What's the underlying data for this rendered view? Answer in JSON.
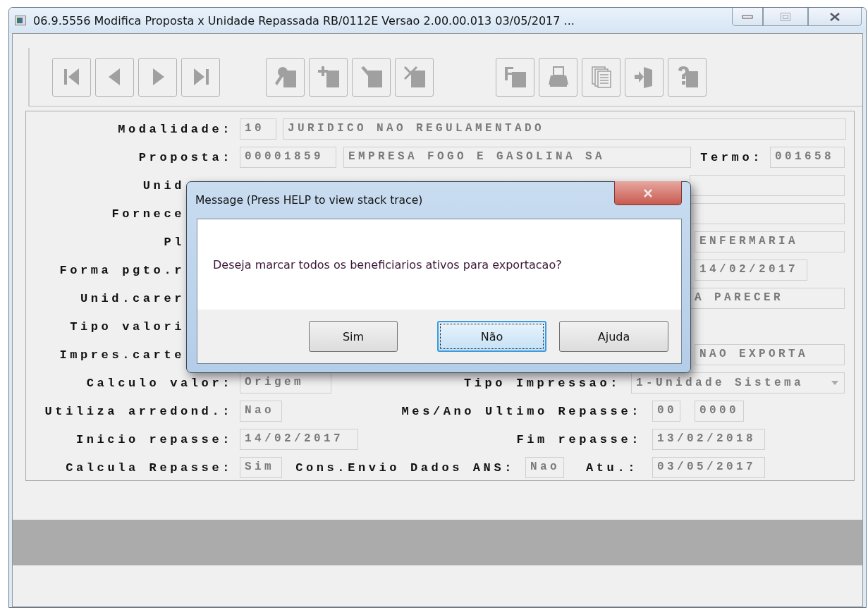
{
  "window": {
    "title": "06.9.5556  Modifica  Proposta x Unidade Repassada RB/0112E Versao 2.00.00.013 03/05/2017 ..."
  },
  "form_rows": [
    {
      "kind": "full",
      "items": [
        {
          "kind": "label",
          "text": "Modalidade:"
        },
        {
          "kind": "field",
          "text": "10"
        },
        {
          "kind": "field",
          "text": "JURIDICO NAO REGULAMENTADO"
        }
      ]
    },
    {
      "kind": "full",
      "items": [
        {
          "kind": "label",
          "text": "Proposta:"
        },
        {
          "kind": "field",
          "text": "00001859"
        },
        {
          "kind": "field",
          "text": "EMPRESA FOGO E GASOLINA SA"
        },
        {
          "kind": "label",
          "text": "Termo:"
        },
        {
          "kind": "field",
          "text": "001658"
        }
      ]
    },
    {
      "kind": "covered",
      "items": [
        {
          "kind": "label",
          "text": "Unid"
        },
        {
          "kind": "field"
        }
      ]
    },
    {
      "kind": "covered",
      "items": [
        {
          "kind": "label",
          "text": "Fornece"
        },
        {
          "kind": "field"
        }
      ]
    },
    {
      "kind": "covered",
      "items": [
        {
          "kind": "label",
          "text": "Pl"
        },
        {
          "kind": "field",
          "text": "ENFERMARIA"
        }
      ]
    },
    {
      "kind": "covered",
      "items": [
        {
          "kind": "label",
          "text": "Forma pgto.r"
        },
        {
          "kind": "field",
          "text": "14/02/2017"
        }
      ]
    },
    {
      "kind": "covered",
      "items": [
        {
          "kind": "label",
          "text": "Unid.carer"
        },
        {
          "kind": "field",
          "text": "A PARECER"
        }
      ]
    },
    {
      "kind": "covered",
      "items": [
        {
          "kind": "label",
          "text": "Tipo valori"
        }
      ]
    },
    {
      "kind": "covered",
      "items": [
        {
          "kind": "label",
          "text": "Impres.carte"
        },
        {
          "kind": "field",
          "text": "NAO EXPORTA"
        }
      ]
    },
    {
      "kind": "full",
      "items": [
        {
          "kind": "label",
          "text": "Calculo valor:"
        },
        {
          "kind": "field",
          "text": "Origem"
        },
        {
          "kind": "label",
          "text": "Tipo Impressao:"
        },
        {
          "kind": "select",
          "text": "1-Unidade Sistema"
        }
      ]
    },
    {
      "kind": "full",
      "items": [
        {
          "kind": "label",
          "text": "Utiliza arredond.:"
        },
        {
          "kind": "field",
          "text": "Nao"
        },
        {
          "kind": "label",
          "text": "Mes/Ano Ultimo Repasse:"
        },
        {
          "kind": "field",
          "text": "00"
        },
        {
          "kind": "field",
          "text": "0000"
        }
      ]
    },
    {
      "kind": "full",
      "items": [
        {
          "kind": "label",
          "text": "Inicio repasse:"
        },
        {
          "kind": "field",
          "text": "14/02/2017"
        },
        {
          "kind": "label",
          "text": "Fim repasse:"
        },
        {
          "kind": "field",
          "text": "13/02/2018"
        }
      ]
    },
    {
      "kind": "full",
      "items": [
        {
          "kind": "label",
          "text": "Calcula Repasse:"
        },
        {
          "kind": "field",
          "text": "Sim"
        },
        {
          "kind": "label",
          "text": "Cons.Envio Dados ANS:"
        },
        {
          "kind": "field",
          "text": "Nao"
        },
        {
          "kind": "label",
          "text": "Atu.:"
        },
        {
          "kind": "field",
          "text": "03/05/2017"
        }
      ]
    }
  ],
  "dialog": {
    "title": "Message (Press HELP to view stack trace)",
    "message": "Deseja marcar todos os beneficiarios ativos para exportacao?",
    "buttons": [
      {
        "label": "Sim",
        "focused": false
      },
      {
        "label": "Não",
        "focused": true
      },
      {
        "label": "Ajuda",
        "focused": false
      }
    ]
  }
}
